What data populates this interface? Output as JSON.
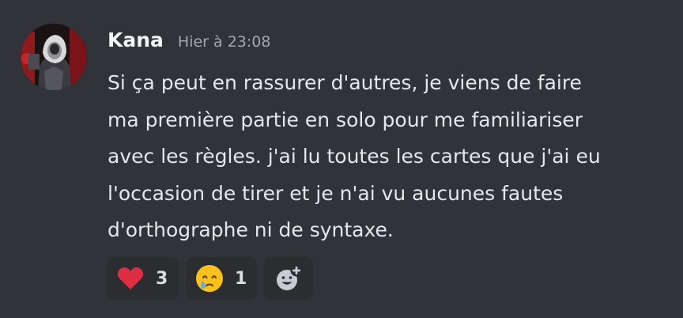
{
  "message": {
    "author": "Kana",
    "timestamp": "Hier à 23:08",
    "lines": [
      "Si ça peut en rassurer d'autres, je viens de faire",
      "ma première partie en solo pour me familiariser",
      "avec les règles. j'ai lu toutes les cartes que j'ai eu",
      "l'occasion de tirer et je n'ai vu aucunes fautes",
      "d'orthographe ni de syntaxe."
    ]
  },
  "reactions": [
    {
      "emoji_icon": "red-heart-icon",
      "count": "3"
    },
    {
      "emoji_icon": "face-holding-back-tears-icon",
      "count": "1"
    }
  ],
  "add_reaction": {
    "icon": "add-reaction-icon"
  },
  "colors": {
    "background": "#313338",
    "username": "#f2f3f5",
    "timestamp": "#a3a6ad",
    "text": "#e6e7ea",
    "reaction_bg": "#2b2d31"
  }
}
